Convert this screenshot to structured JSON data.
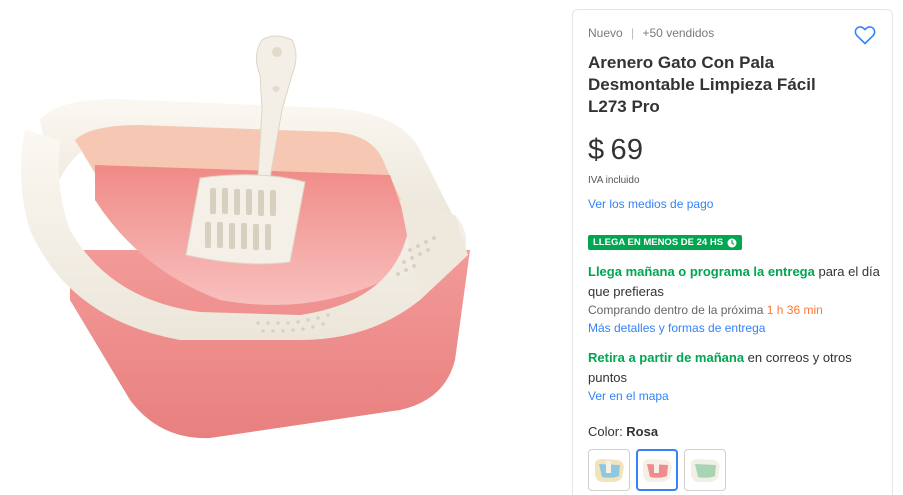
{
  "product": {
    "condition": "Nuevo",
    "separator": "|",
    "sold": "+50 vendidos",
    "title": "Arenero Gato Con Pala Desmontable Limpieza Fácil L273 Pro",
    "currency": "$",
    "price": "69",
    "tax_note": "IVA incluido",
    "payment_link": "Ver los medios de pago"
  },
  "shipping": {
    "badge": "LLEGA EN MENOS DE 24 HS",
    "delivery_highlight": "Llega mañana o programa la entrega",
    "delivery_rest": " para el día que prefieras",
    "countdown_prefix": "Comprando dentro de la próxima ",
    "countdown_time": "1 h 36 min",
    "details_link": "Más detalles y formas de entrega",
    "pickup_highlight": "Retira a partir de mañana",
    "pickup_rest": " en correos y otros puntos",
    "map_link": "Ver en el mapa"
  },
  "variants": {
    "label": "Color: ",
    "selected": "Rosa",
    "options": [
      "Celeste",
      "Rosa",
      "Verde"
    ]
  },
  "colors": {
    "accent": "#3483fa",
    "green": "#00a650",
    "orange": "#ff7733",
    "pink": "#f08c8c",
    "cream": "#f6f2ea"
  },
  "icons": {
    "favorite": "heart-icon",
    "badge": "clock-icon"
  }
}
